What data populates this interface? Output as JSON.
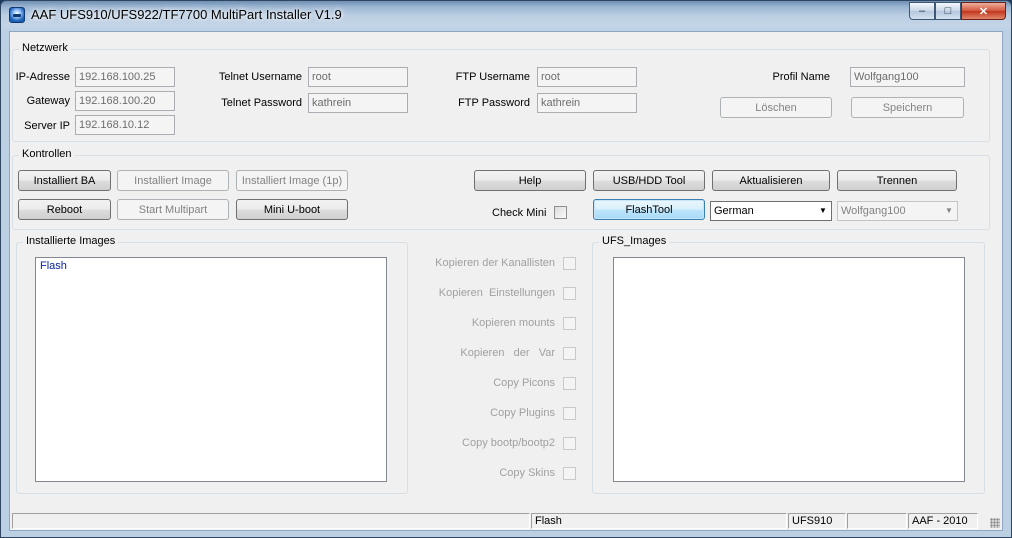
{
  "window": {
    "title": "AAF UFS910/UFS922/TF7700 MultiPart Installer V1.9",
    "min_glyph": "–",
    "max_glyph": "□",
    "close_glyph": "✕"
  },
  "netzwerk": {
    "label": "Netzwerk",
    "ip_label": "IP-Adresse",
    "ip_value": "192.168.100.25",
    "gateway_label": "Gateway",
    "gateway_value": "192.168.100.20",
    "server_label": "Server IP",
    "server_value": "192.168.10.12",
    "telnet_user_label": "Telnet Username",
    "telnet_user_value": "root",
    "telnet_pass_label": "Telnet Password",
    "telnet_pass_value": "kathrein",
    "ftp_user_label": "FTP Username",
    "ftp_user_value": "root",
    "ftp_pass_label": "FTP Password",
    "ftp_pass_value": "kathrein",
    "profil_label": "Profil Name",
    "profil_value": "Wolfgang100",
    "loeschen": "Löschen",
    "speichern": "Speichern"
  },
  "kontrollen": {
    "label": "Kontrollen",
    "installiert_ba": "Installiert BA",
    "installiert_image": "Installiert Image",
    "installiert_image_1p": "Installiert Image (1p)",
    "reboot": "Reboot",
    "start_multipart": "Start Multipart",
    "mini_uboot": "Mini U-boot",
    "help": "Help",
    "usb_hdd": "USB/HDD Tool",
    "aktualisieren": "Aktualisieren",
    "trennen": "Trennen",
    "check_mini": "Check Mini",
    "flashtool": "FlashTool",
    "language": "German",
    "profile_select": "Wolfgang100"
  },
  "installierte": {
    "label": "Installierte Images",
    "items": [
      "Flash"
    ]
  },
  "options": [
    "Kopieren der Kanallisten",
    "Kopieren  Einstellungen",
    "Kopieren mounts",
    "Kopieren   der   Var",
    "Copy Picons",
    "Copy Plugins",
    "Copy bootp/bootp2",
    "Copy Skins"
  ],
  "ufs_images": {
    "label": "UFS_Images"
  },
  "status": {
    "panel1": "",
    "panel2": "Flash",
    "panel3": "UFS910",
    "panel4": "",
    "panel5": "AAF - 2010"
  }
}
